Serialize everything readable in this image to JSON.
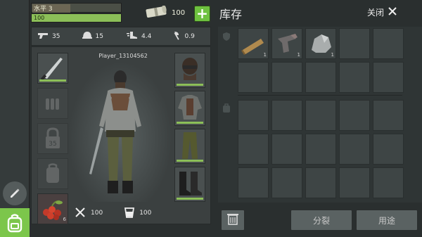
{
  "player": {
    "level_label": "水平 3",
    "level_fraction": 0.42,
    "health_value": "100",
    "name": "Player_13104562"
  },
  "currency": {
    "amount": "100",
    "icon": "cash-roll-icon",
    "add_icon": "plus-icon"
  },
  "stats": [
    {
      "icon": "gun-icon",
      "value": "35"
    },
    {
      "icon": "helmet-icon",
      "value": "15"
    },
    {
      "icon": "boots-speed-icon",
      "value": "4.4"
    },
    {
      "icon": "axe-icon",
      "value": "0.9"
    }
  ],
  "equipment_left": [
    {
      "slot": "weapon",
      "item": "machete-icon",
      "durability": 1.0
    },
    {
      "slot": "ammo",
      "item": "ammo-icon",
      "empty": true
    },
    {
      "slot": "level-lock",
      "item": "lock-icon",
      "label": "35",
      "empty": true
    },
    {
      "slot": "backpack",
      "item": "backpack-icon",
      "empty": true
    },
    {
      "slot": "food",
      "item": "berries-icon",
      "count": "6"
    }
  ],
  "equipment_right": [
    {
      "slot": "head",
      "item": "balaclava-icon",
      "durability": 1.0
    },
    {
      "slot": "torso",
      "item": "jacket-icon",
      "durability": 1.0
    },
    {
      "slot": "legs",
      "item": "pants-icon",
      "durability": 1.0
    },
    {
      "slot": "feet",
      "item": "boots-icon",
      "durability": 1.0
    }
  ],
  "vitals": [
    {
      "icon": "fork-knife-icon",
      "value": "100"
    },
    {
      "icon": "water-cup-icon",
      "value": "100"
    }
  ],
  "inventory": {
    "title": "库存",
    "close_label": "关闭",
    "items": [
      {
        "item": "wood-plank-icon",
        "qty": "1"
      },
      {
        "item": "fabric-scrap-icon",
        "qty": "1"
      },
      {
        "item": "stone-icon",
        "qty": "1"
      }
    ]
  },
  "actions": {
    "split_label": "分裂",
    "use_label": "用途"
  },
  "colors": {
    "accent_green": "#8cbf58",
    "button_green": "#6ec13f",
    "panel_dark": "#2f3535"
  }
}
